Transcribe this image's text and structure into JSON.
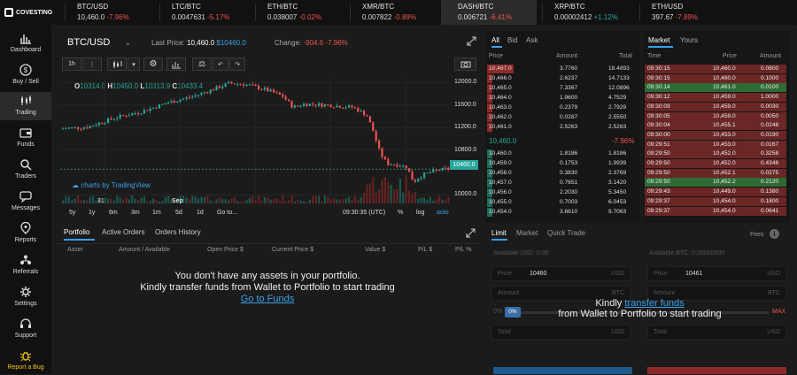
{
  "brand": {
    "name": "COVESTING"
  },
  "tickers": [
    {
      "pair": "BTC/USD",
      "price": "10,460.0",
      "change": "-7.96%",
      "dir": "neg"
    },
    {
      "pair": "LTC/BTC",
      "price": "0.0047631",
      "change": "-5.17%",
      "dir": "neg"
    },
    {
      "pair": "ETH/BTC",
      "price": "0.038007",
      "change": "-0.02%",
      "dir": "neg"
    },
    {
      "pair": "XMR/BTC",
      "price": "0.007822",
      "change": "-0.89%",
      "dir": "neg"
    },
    {
      "pair": "DASH/BTC",
      "price": "0.006721",
      "change": "-6.41%",
      "dir": "neg"
    },
    {
      "pair": "XRP/BTC",
      "price": "0.00002412",
      "change": "+1.12%",
      "dir": "pos"
    },
    {
      "pair": "ETH/USD",
      "price": "397.67",
      "change": "-7.89%",
      "dir": "neg"
    }
  ],
  "sidebar": [
    {
      "label": "Dashboard",
      "icon": "dashboard-icon"
    },
    {
      "label": "Buy / Sell",
      "icon": "exchange-icon"
    },
    {
      "label": "Trading",
      "icon": "trading-icon",
      "active": true
    },
    {
      "label": "Funds",
      "icon": "wallet-icon"
    },
    {
      "label": "Traders",
      "icon": "search-icon"
    },
    {
      "label": "Messages",
      "icon": "chat-icon"
    },
    {
      "label": "Reports",
      "icon": "location-icon"
    },
    {
      "label": "Referrals",
      "icon": "referrals-icon"
    },
    {
      "label": "Settings",
      "icon": "gear-icon"
    },
    {
      "label": "Support",
      "icon": "support-icon"
    },
    {
      "label": "Report a Bug",
      "icon": "bug-icon"
    }
  ],
  "chart_header": {
    "pair": "BTC/USD",
    "last_price_label": "Last Price:",
    "last_price": "10,460.0",
    "last_price_alt": "$10460.0",
    "change_label": "Change:",
    "change_value": "-904.6",
    "change_pct": "-7.96%"
  },
  "toolbar": {
    "interval": "1h"
  },
  "ohlc": {
    "o_label": "O",
    "o": "10314.0",
    "h_label": "H",
    "h": "10450.0",
    "l_label": "L",
    "l": "10313.9",
    "c_label": "C",
    "c": "10433.4"
  },
  "watermark": "charts by TradingView",
  "chart_data": {
    "type": "candlestick",
    "y_ticks": [
      "12000.0",
      "11600.0",
      "11200.0",
      "10800.0",
      "10000.0"
    ],
    "ylim": [
      9850,
      12100
    ],
    "x_ticks": [
      "31",
      "Sep"
    ],
    "last_value": "10460.0",
    "last": 10460
  },
  "timeframes": [
    "5y",
    "1y",
    "6m",
    "3m",
    "1m",
    "5d",
    "1d",
    "Go to..."
  ],
  "chart_footer": {
    "time": "09:30:35 (UTC)",
    "pct": "%",
    "log": "log",
    "auto": "auto"
  },
  "bottom_tabs": [
    "Portfolio",
    "Active Orders",
    "Orders History"
  ],
  "portfolio_columns": [
    "Asset",
    "Amount / Available",
    "Open Price $",
    "Current Price $",
    "Value $",
    "P/L $",
    "P/L %"
  ],
  "portfolio_empty": {
    "line1": "You don't have any assets in your portfolio.",
    "line2": "Kindly transfer funds from Wallet to Portfolio to start trading",
    "link": "Go to Funds"
  },
  "orderbook": {
    "tabs": [
      "All",
      "Bid",
      "Ask"
    ],
    "columns": [
      "Price",
      "Amount",
      "Total"
    ],
    "asks": [
      [
        "10,467.0",
        "3.7760",
        "18.4893"
      ],
      [
        "10,466.0",
        "2.6237",
        "14.7133"
      ],
      [
        "10,465.0",
        "7.3367",
        "12.0896"
      ],
      [
        "10,464.0",
        "1.9600",
        "4.7529"
      ],
      [
        "10,463.0",
        "0.2379",
        "2.7929"
      ],
      [
        "10,462.0",
        "0.0287",
        "2.5550"
      ],
      [
        "10,461.0",
        "2.5263",
        "2.5263"
      ]
    ],
    "mid_price": "10,460.0",
    "mid_change": "-7.96%",
    "bids": [
      [
        "10,460.0",
        "1.8186",
        "1.8186"
      ],
      [
        "10,459.0",
        "0.1753",
        "1.9939"
      ],
      [
        "10,458.0",
        "0.3830",
        "2.3769"
      ],
      [
        "10,457.0",
        "0.7651",
        "3.1420"
      ],
      [
        "10,456.0",
        "2.2030",
        "5.3450"
      ],
      [
        "10,455.0",
        "0.7003",
        "6.0453"
      ],
      [
        "10,454.0",
        "3.6610",
        "9.7063"
      ]
    ]
  },
  "market_trades": {
    "tabs": [
      "Market",
      "Yours"
    ],
    "columns": [
      "Time",
      "Price",
      "Amount"
    ],
    "rows": [
      [
        "09:30:15",
        "10,460.0",
        "0.0800",
        "neg"
      ],
      [
        "09:30:15",
        "10,460.0",
        "0.1000",
        "neg"
      ],
      [
        "09:30:14",
        "10,461.0",
        "0.0100",
        "pos"
      ],
      [
        "09:30:12",
        "10,459.0",
        "1.0000",
        "neg"
      ],
      [
        "09:30:09",
        "10,459.0",
        "0.0030",
        "neg"
      ],
      [
        "09:30:05",
        "10,459.0",
        "0.0050",
        "neg"
      ],
      [
        "09:30:04",
        "10,455.1",
        "0.0248",
        "neg"
      ],
      [
        "09:30:00",
        "10,453.0",
        "0.0190",
        "neg"
      ],
      [
        "09:29:51",
        "10,453.0",
        "0.0167",
        "neg"
      ],
      [
        "09:29:50",
        "10,452.0",
        "0.3258",
        "neg"
      ],
      [
        "09:29:50",
        "10,452.0",
        "0.4348",
        "neg"
      ],
      [
        "09:29:50",
        "10,452.1",
        "0.0275",
        "neg"
      ],
      [
        "09:29:50",
        "10,452.2",
        "0.2120",
        "pos"
      ],
      [
        "09:29:43",
        "10,449.0",
        "0.1380",
        "neg"
      ],
      [
        "09:29:37",
        "10,454.0",
        "0.1800",
        "neg"
      ],
      [
        "09:29:37",
        "10,454.0",
        "0.0641",
        "neg"
      ]
    ]
  },
  "order_form": {
    "tabs": [
      "Limit",
      "Market",
      "Quick Trade"
    ],
    "fees_label": "Fees",
    "available_usd": "Available USD: 0.00",
    "available_btc": "Available BTC: 0.00000000",
    "price_label": "Price",
    "amount_label": "Amount",
    "total_label": "Total",
    "buy_price": "10460",
    "sell_price": "10461",
    "usd": "USD",
    "btc": "BTC",
    "slider_min": "0%",
    "slider_val": "0%",
    "slider_max": "MAX",
    "overlay_pre": "Kindly",
    "overlay_link": "transfer funds",
    "overlay_line2": "from Wallet to Portfolio to start trading"
  },
  "colors": {
    "up": "#26a69a",
    "down": "#ef5350",
    "accent": "#3aa0e8"
  }
}
